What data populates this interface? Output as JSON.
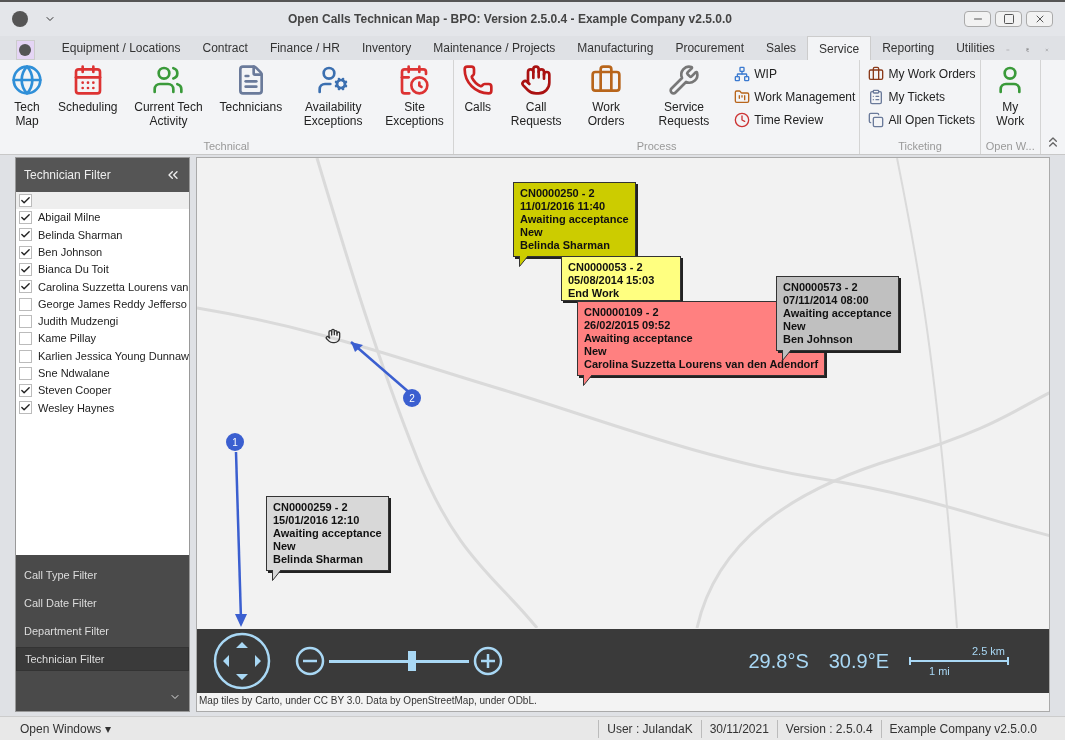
{
  "window": {
    "title": "Open Calls Technican Map - BPO: Version 2.5.0.4 - Example Company v2.5.0.0"
  },
  "menu_tabs": [
    {
      "label": "Equipment / Locations",
      "selected": false
    },
    {
      "label": "Contract",
      "selected": false
    },
    {
      "label": "Finance / HR",
      "selected": false
    },
    {
      "label": "Inventory",
      "selected": false
    },
    {
      "label": "Maintenance / Projects",
      "selected": false
    },
    {
      "label": "Manufacturing",
      "selected": false
    },
    {
      "label": "Procurement",
      "selected": false
    },
    {
      "label": "Sales",
      "selected": false
    },
    {
      "label": "Service",
      "selected": true
    },
    {
      "label": "Reporting",
      "selected": false
    },
    {
      "label": "Utilities",
      "selected": false
    }
  ],
  "ribbon_groups": [
    {
      "label": "Technical",
      "items": [
        {
          "kind": "large",
          "label": "Tech Map"
        },
        {
          "kind": "large",
          "label": "Scheduling"
        },
        {
          "kind": "large",
          "label": "Current Tech Activity"
        },
        {
          "kind": "large",
          "label": "Technicians"
        },
        {
          "kind": "large",
          "label": "Availability Exceptions"
        },
        {
          "kind": "large",
          "label": "Site Exceptions"
        }
      ]
    },
    {
      "label": "Process",
      "items": [
        {
          "kind": "large",
          "label": "Calls"
        },
        {
          "kind": "large",
          "label": "Call Requests"
        },
        {
          "kind": "large",
          "label": "Work Orders"
        },
        {
          "kind": "large",
          "label": "Service Requests"
        },
        {
          "kind": "small",
          "label": "WIP"
        },
        {
          "kind": "small",
          "label": "Work Management"
        },
        {
          "kind": "small",
          "label": "Time Review"
        }
      ]
    },
    {
      "label": "Ticketing",
      "items": [
        {
          "kind": "small",
          "label": "My Work Orders"
        },
        {
          "kind": "small",
          "label": "My Tickets"
        },
        {
          "kind": "small",
          "label": "All Open Tickets"
        }
      ]
    },
    {
      "label": "Open W...",
      "items": [
        {
          "kind": "large",
          "label": "My Work"
        }
      ]
    }
  ],
  "filter_panel": {
    "title": "Technician Filter",
    "select_all": {
      "checked": true
    },
    "technicians": [
      {
        "name": "Abigail Milne",
        "checked": true
      },
      {
        "name": "Belinda Sharman",
        "checked": true
      },
      {
        "name": "Ben Johnson",
        "checked": true
      },
      {
        "name": "Bianca Du Toit",
        "checked": true
      },
      {
        "name": "Carolina Suzzetta Lourens van",
        "checked": true
      },
      {
        "name": "George James Reddy Jefferso",
        "checked": false
      },
      {
        "name": "Judith Mudzengi",
        "checked": false
      },
      {
        "name": "Kame Pillay",
        "checked": false
      },
      {
        "name": "Karlien Jessica Young Dunnaw",
        "checked": false
      },
      {
        "name": "Sne Ndwalane",
        "checked": false
      },
      {
        "name": "Steven Cooper",
        "checked": true
      },
      {
        "name": "Wesley Haynes",
        "checked": true
      }
    ],
    "filters": [
      {
        "label": "Call Type Filter",
        "selected": false
      },
      {
        "label": "Call Date Filter",
        "selected": false
      },
      {
        "label": "Department Filter",
        "selected": false
      },
      {
        "label": "Technician Filter",
        "selected": true
      }
    ]
  },
  "map": {
    "callouts": [
      {
        "color": "#cccc00",
        "lines": [
          "CN0000250 - 2",
          "11/01/2016 11:40",
          "Awaiting acceptance",
          "New",
          "Belinda Sharman"
        ]
      },
      {
        "color": "#ffff80",
        "lines": [
          "CN0000053 - 2",
          "05/08/2014 15:03",
          "End Work"
        ]
      },
      {
        "color": "#ff8080",
        "lines": [
          "CN0000109 - 2",
          "26/02/2015 09:52",
          "Awaiting acceptance",
          "New",
          "Carolina Suzzetta Lourens van den Adendorf"
        ]
      },
      {
        "color": "#c0c0c0",
        "lines": [
          "CN0000573 - 2",
          "07/11/2014 08:00",
          "Awaiting acceptance",
          "New",
          "Ben Johnson"
        ]
      },
      {
        "color": "#d8d8d8",
        "lines": [
          "CN0000259 - 2",
          "15/01/2016 12:10",
          "Awaiting acceptance",
          "New",
          "Belinda Sharman"
        ]
      }
    ],
    "annotations": [
      "1",
      "2"
    ],
    "zoom": {
      "level": 0.59
    },
    "latitude": "29.8°S",
    "longitude": "30.9°E",
    "scale": {
      "metric": "2.5 km",
      "imperial": "1 mi"
    },
    "attribution": "Map tiles by Carto, under CC BY 3.0. Data by OpenStreetMap, under ODbL."
  },
  "status_bar": {
    "open_windows": "Open Windows ▾",
    "cells": [
      "User : JulandaK",
      "30/11/2021",
      "Version : 2.5.0.4",
      "Example Company v2.5.0.0"
    ]
  }
}
